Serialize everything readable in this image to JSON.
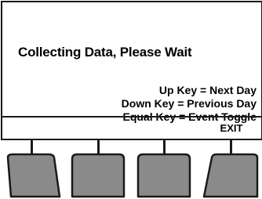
{
  "display": {
    "status_message": "Collecting Data, Please Wait",
    "help_lines": [
      "Up Key = Next Day",
      "Down Key = Previous Day",
      "Equal Key = Event Toggle"
    ]
  },
  "softkeys": {
    "labels": [
      "",
      "",
      "",
      "EXIT"
    ]
  },
  "colors": {
    "key_fill": "#8a8a8a",
    "outline": "#1a1a1a"
  }
}
